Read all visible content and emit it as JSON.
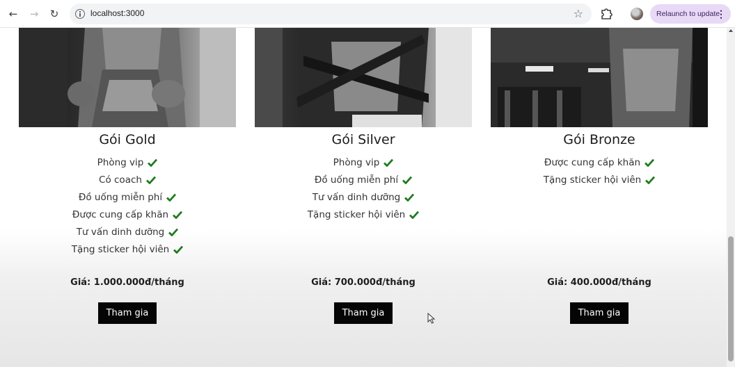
{
  "browser": {
    "url": "localhost:3000",
    "relaunch_label": "Relaunch to update",
    "icons": [
      "back-arrow-icon",
      "forward-arrow-icon",
      "reload-icon",
      "site-info-icon",
      "bookmark-star-icon",
      "extensions-puzzle-icon",
      "profile-avatar",
      "kebab-menu-icon"
    ]
  },
  "colors": {
    "check": "#1f7a1f",
    "button_bg": "#050505",
    "relaunch_bg": "#e8d9f6"
  },
  "plans": [
    {
      "title": "Gói Gold",
      "features": [
        "Phòng vip",
        "Có coach",
        "Đồ uống miễn phí",
        "Được cung cấp khăn",
        "Tư vấn dinh dưỡng",
        "Tặng sticker hội viên"
      ],
      "price": "Giá: 1.000.000đ/tháng",
      "button": "Tham gia"
    },
    {
      "title": "Gói Silver",
      "features": [
        "Phòng vip",
        "Đồ uống miễn phí",
        "Tư vấn dinh dưỡng",
        "Tặng sticker hội viên"
      ],
      "price": "Giá: 700.000đ/tháng",
      "button": "Tham gia"
    },
    {
      "title": "Gói Bronze",
      "features": [
        "Được cung cấp khăn",
        "Tặng sticker hội viên"
      ],
      "price": "Giá: 400.000đ/tháng",
      "button": "Tham gia"
    }
  ]
}
